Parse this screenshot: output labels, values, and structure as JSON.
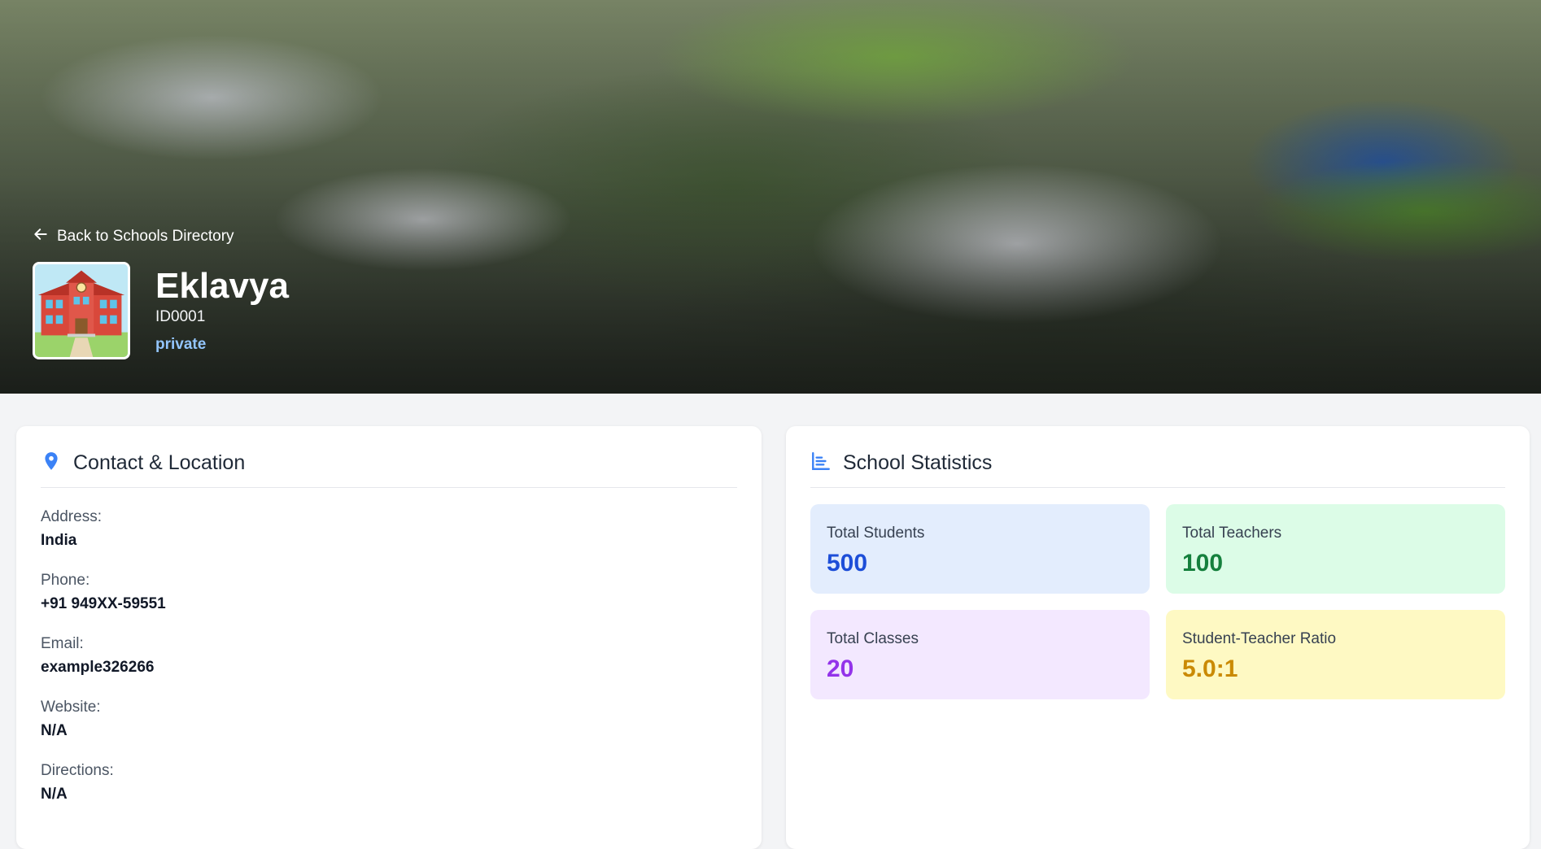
{
  "hero": {
    "back_label": "Back to Schools Directory",
    "school_name": "Eklavya",
    "school_id": "ID0001",
    "school_type": "private"
  },
  "contact": {
    "title": "Contact & Location",
    "fields": [
      {
        "label": "Address:",
        "value": "India"
      },
      {
        "label": "Phone:",
        "value": "+91 949XX-59551"
      },
      {
        "label": "Email:",
        "value": "example326266"
      },
      {
        "label": "Website:",
        "value": "N/A"
      },
      {
        "label": "Directions:",
        "value": "N/A"
      }
    ]
  },
  "stats": {
    "title": "School Statistics",
    "items": [
      {
        "label": "Total Students",
        "value": "500",
        "bg": "#e3edfd",
        "color": "#1d4ed8"
      },
      {
        "label": "Total Teachers",
        "value": "100",
        "bg": "#dcfce7",
        "color": "#15803d"
      },
      {
        "label": "Total Classes",
        "value": "20",
        "bg": "#f3e8ff",
        "color": "#9333ea"
      },
      {
        "label": "Student-Teacher Ratio",
        "value": "5.0:1",
        "bg": "#fef9c3",
        "color": "#ca8a04"
      }
    ]
  },
  "icons": {
    "back": "arrow-left-icon",
    "location": "map-pin-icon",
    "stats": "bar-chart-icon"
  },
  "colors": {
    "accent": "#3b82f6",
    "type_badge": "#93c5fd"
  }
}
